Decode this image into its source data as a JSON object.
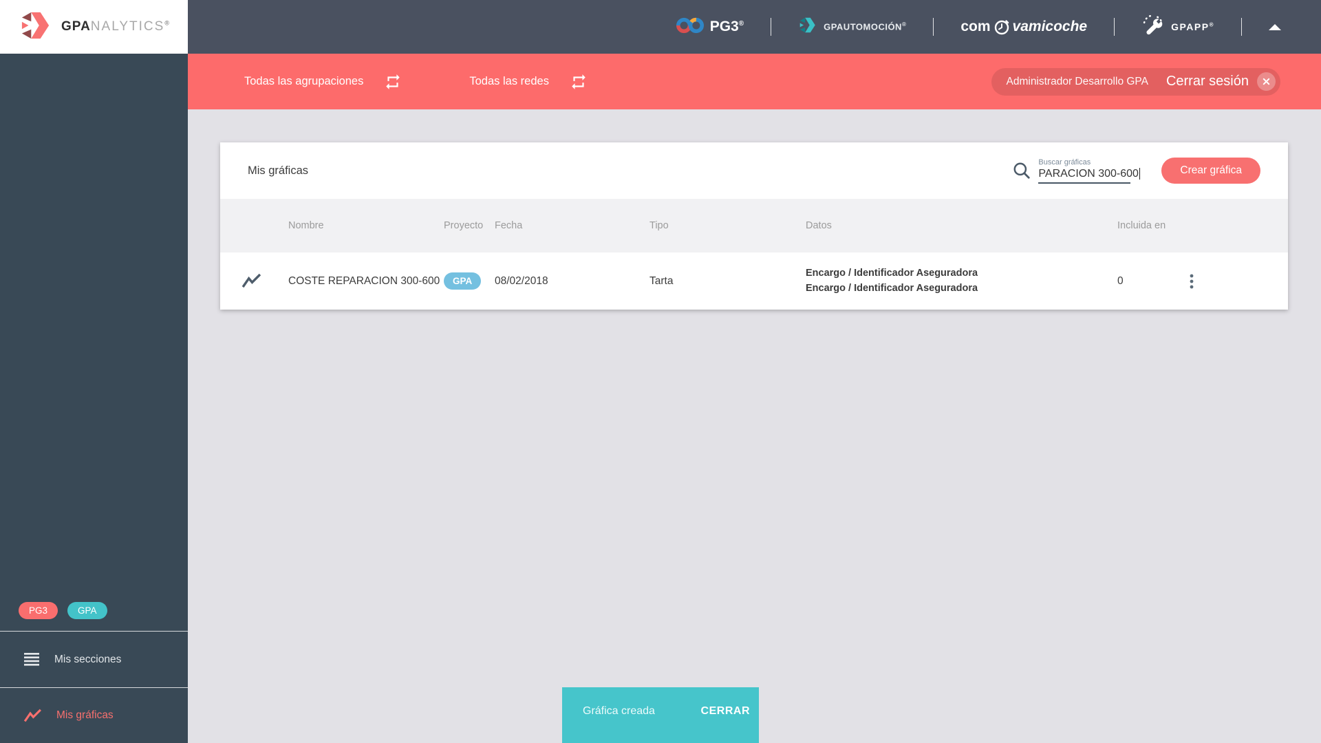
{
  "header": {
    "logo": {
      "gpa": "GPA",
      "nalytics": "NALYTICS",
      "reg": "®"
    },
    "brands": {
      "pg3": {
        "label": "PG3",
        "reg": "®"
      },
      "gpautomocion": {
        "label": "GPAUTOMOCIÓN",
        "reg": "®"
      },
      "compravamicoche": {
        "com": "com",
        "coche": "vamicoche"
      },
      "gpapp": {
        "label": "GPAPP",
        "reg": "®"
      }
    }
  },
  "filter_bar": {
    "groupings_label": "Todas las agrupaciones",
    "networks_label": "Todas las redes",
    "user_label": "Administrador Desarrollo GPA",
    "logout_label": "Cerrar sesión"
  },
  "sidebar": {
    "badges": [
      {
        "label": "PG3"
      },
      {
        "label": "GPA"
      }
    ],
    "items": [
      {
        "label": "Mis secciones",
        "active": false
      },
      {
        "label": "Mis gráficas",
        "active": true
      }
    ]
  },
  "content": {
    "title": "Mis gráficas",
    "search": {
      "label": "Buscar gráficas",
      "value": "PARACION 300-600"
    },
    "create_button": "Crear gráfica",
    "table": {
      "columns": [
        "Nombre",
        "Proyecto",
        "Fecha",
        "Tipo",
        "Datos",
        "Incluida en"
      ],
      "rows": [
        {
          "name": "COSTE REPARACION 300-600",
          "project": "GPA",
          "date": "08/02/2018",
          "type": "Tarta",
          "data_lines": [
            "Encargo / Identificador Aseguradora",
            "Encargo / Identificador Aseguradora"
          ],
          "included_in": "0"
        }
      ]
    }
  },
  "snackbar": {
    "message": "Gráfica creada",
    "action": "CERRAR"
  },
  "colors": {
    "header_bg": "#4a5160",
    "sidebar_bg": "#394956",
    "accent_coral": "#fd6b6b",
    "accent_teal": "#46c5cb",
    "project_badge_blue": "#74c0e0",
    "page_bg": "#e2e1e6"
  }
}
